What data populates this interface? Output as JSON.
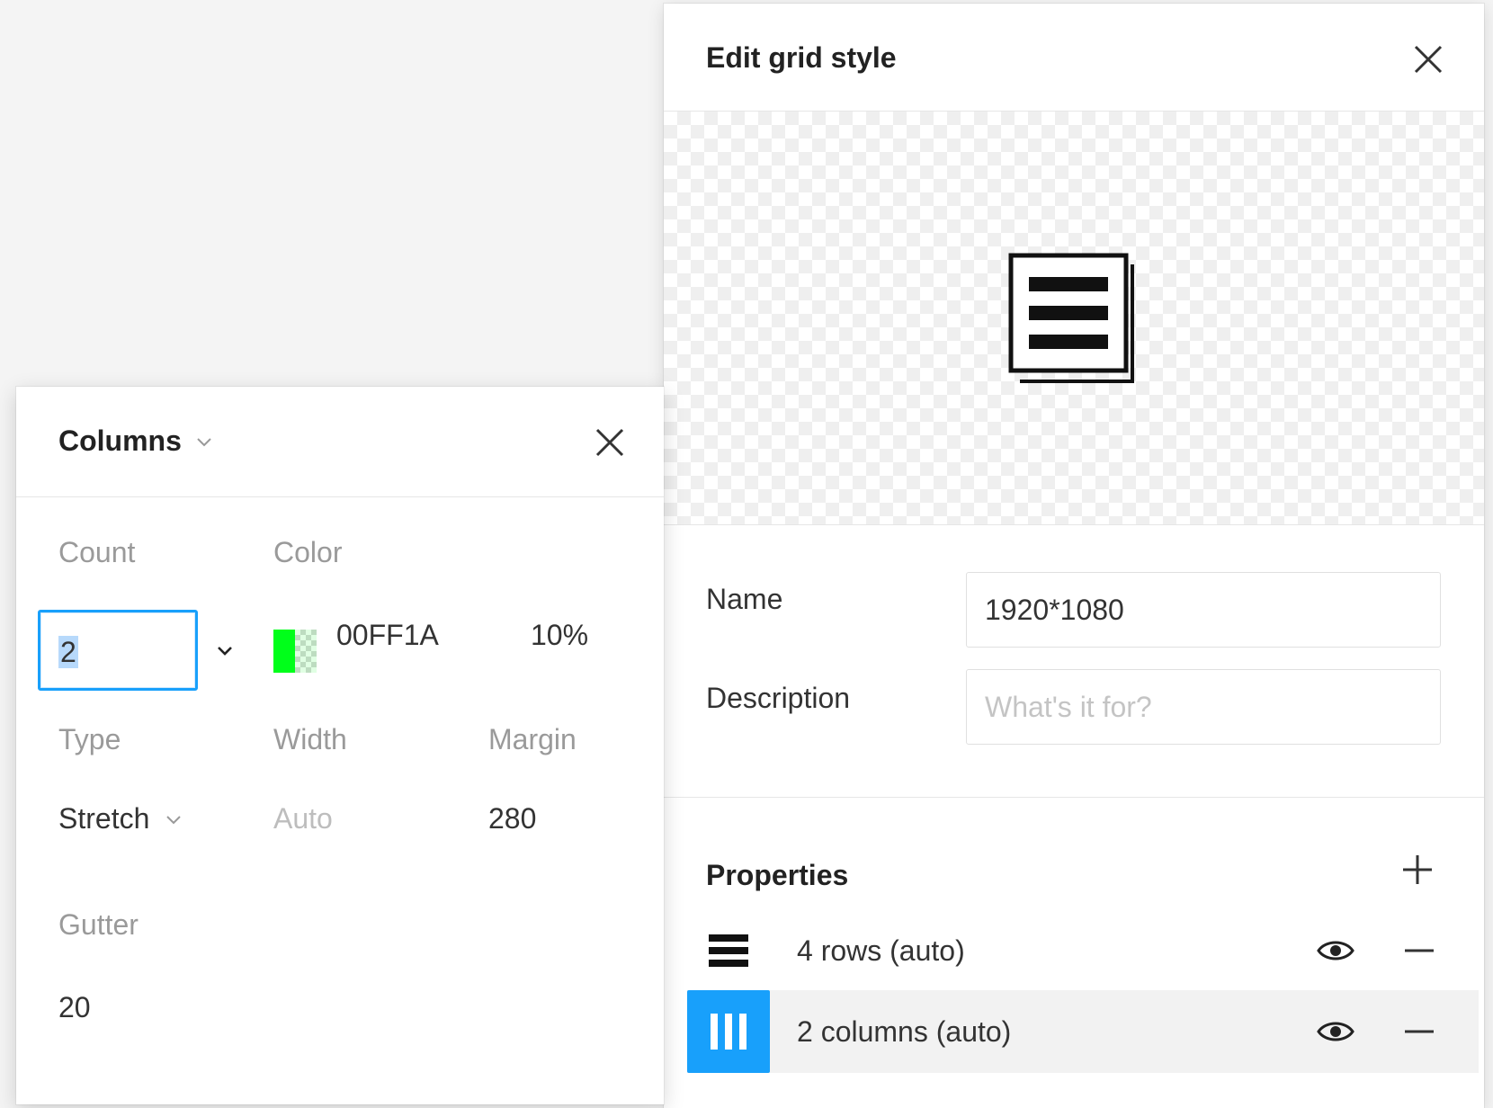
{
  "grid_style": {
    "title": "Edit grid style",
    "name_label": "Name",
    "name_value": "1920*1080",
    "description_label": "Description",
    "description_placeholder": "What's it for?",
    "properties_title": "Properties",
    "properties": [
      {
        "label": "4 rows (auto)",
        "icon": "rows-icon",
        "selected": false
      },
      {
        "label": "2 columns (auto)",
        "icon": "columns-icon",
        "selected": true
      }
    ]
  },
  "columns_panel": {
    "title": "Columns",
    "count_label": "Count",
    "count_value": "2",
    "color_label": "Color",
    "color_hex": "00FF1A",
    "color_swatch": "#00FF1A",
    "opacity": "10%",
    "type_label": "Type",
    "type_value": "Stretch",
    "width_label": "Width",
    "width_value": "Auto",
    "margin_label": "Margin",
    "margin_value": "280",
    "gutter_label": "Gutter",
    "gutter_value": "20"
  },
  "colors": {
    "accent": "#18A0FB",
    "selected_row": "#F2F2F2"
  }
}
